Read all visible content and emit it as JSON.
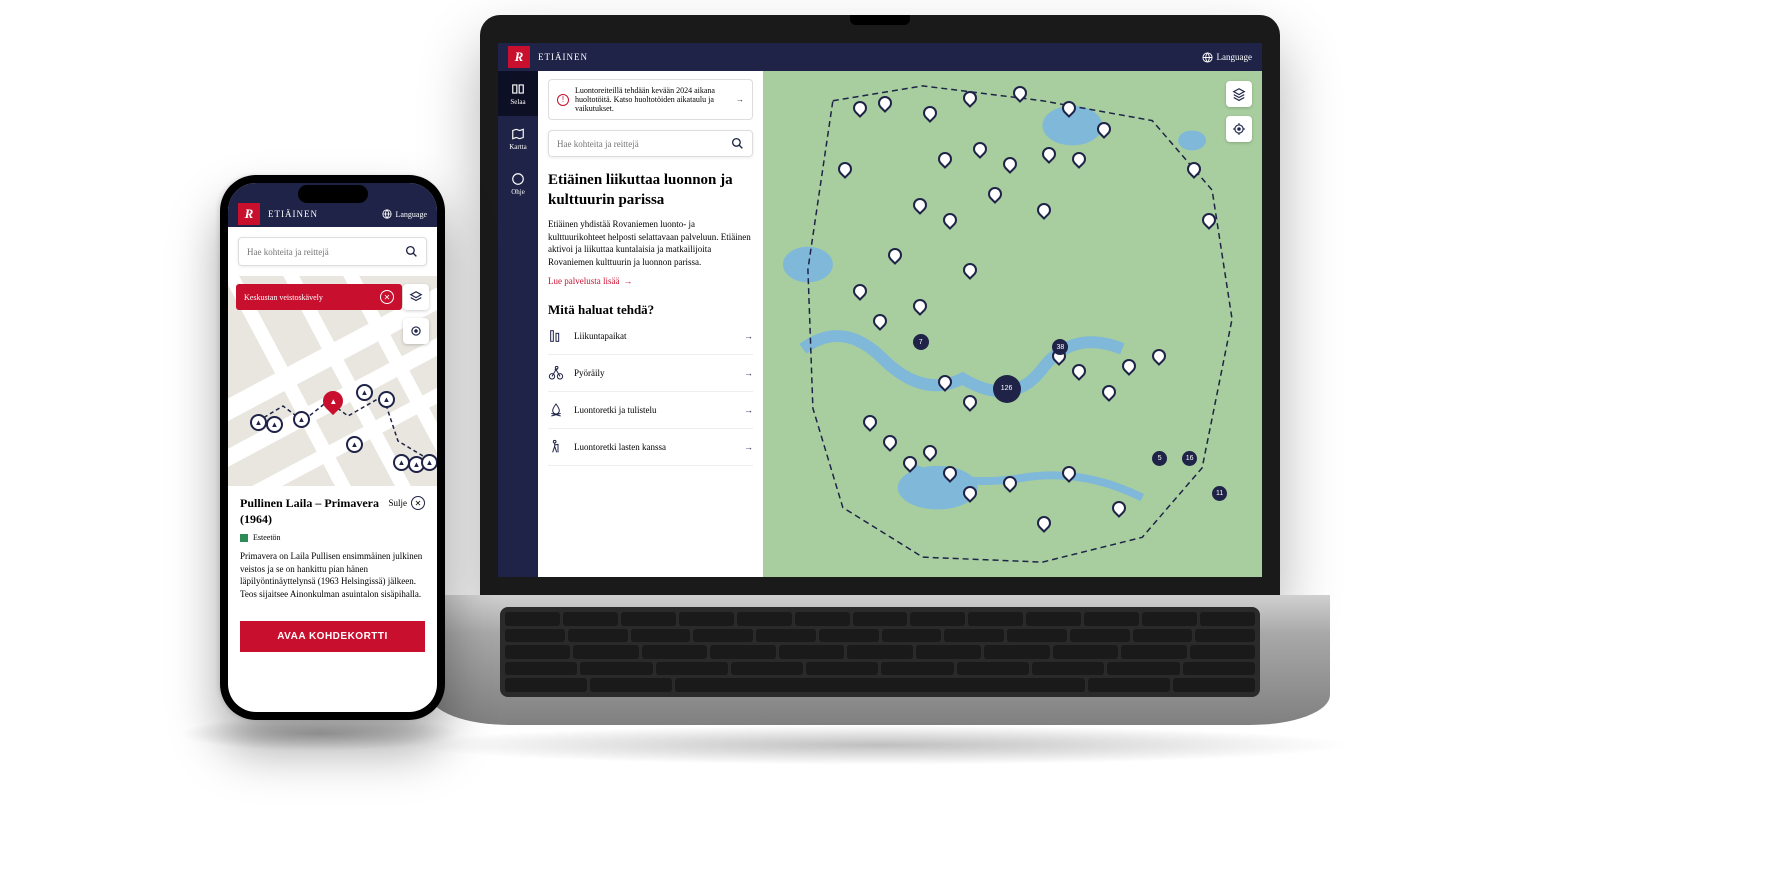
{
  "brand": {
    "name": "ETIÄINEN",
    "logo_letter": "R"
  },
  "language": {
    "label": "Language"
  },
  "laptop": {
    "nav": {
      "browse": "Selaa",
      "map": "Kartta",
      "help": "Ohje"
    },
    "notice": "Luontoreiteillä tehdään kevään 2024 aikana huoltotöitä. Katso huoltotöiden aikataulu ja vaikutukset.",
    "search": {
      "placeholder": "Hae kohteita ja reittejä"
    },
    "heading": "Etiäinen liikuttaa luonnon ja kulttuurin parissa",
    "intro": "Etiäinen yhdistää Rovaniemen luonto- ja kulttuurikohteet helposti selattavaan palveluun. Etiäinen aktivoi ja liikuttaa kuntalaisia ja matkailijoita Rovaniemen kulttuurin ja luonnon parissa.",
    "read_more": "Lue palvelusta lisää",
    "subheading": "Mitä haluat tehdä?",
    "categories": [
      {
        "label": "Liikuntapaikat"
      },
      {
        "label": "Pyöräily"
      },
      {
        "label": "Luontoretki ja tulistelu"
      },
      {
        "label": "Luontoretki lasten kanssa"
      }
    ],
    "clusters": {
      "big": "126",
      "small1": "5",
      "small2": "16",
      "small3": "11",
      "c7": "7",
      "c38": "38"
    }
  },
  "phone": {
    "search": {
      "placeholder": "Hae kohteita ja reittejä"
    },
    "chip": "Keskustan veistoskävely",
    "card": {
      "title": "Pullinen Laila – Primavera (1964)",
      "close": "Sulje",
      "tag": "Esteetön",
      "description": "Primavera on Laila Pullisen ensimmäinen julkinen veistos ja se on hankittu pian hänen läpilyöntinäyttelynsä (1963 Helsingissä) jälkeen. Teos sijaitsee Ainonkulman asuintalon sisäpihalla.",
      "cta": "AVAA KOHDEKORTTI"
    }
  },
  "colors": {
    "brand_red": "#c8102e",
    "navy": "#1e2347",
    "map_green": "#a8ce9f"
  }
}
